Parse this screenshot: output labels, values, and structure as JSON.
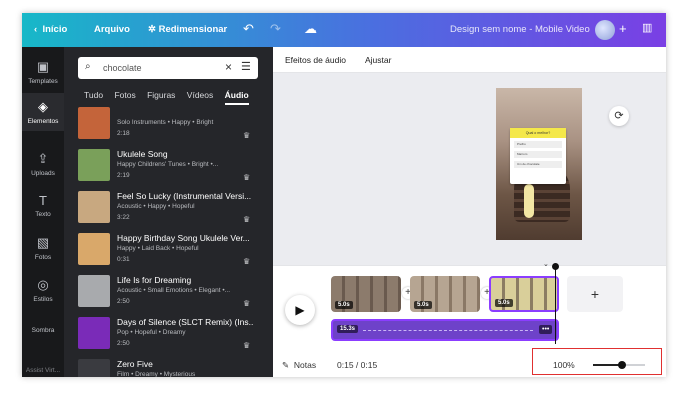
{
  "topbar": {
    "home_label": "Início",
    "file_label": "Arquivo",
    "resize_label": "Redimensionar",
    "doc_name": "Design sem nome - Mobile Video"
  },
  "rail": {
    "items": [
      {
        "label": "Templates",
        "icon": "templates-icon"
      },
      {
        "label": "Elementos",
        "icon": "elements-icon"
      },
      {
        "label": "Uploads",
        "icon": "upload-icon"
      },
      {
        "label": "Texto",
        "icon": "text-icon"
      },
      {
        "label": "Fotos",
        "icon": "photo-icon"
      },
      {
        "label": "Estilos",
        "icon": "palette-icon"
      },
      {
        "label": "Sombra",
        "icon": "shadow-icon"
      },
      {
        "label": "Assist Virt...",
        "icon": "assistant-icon"
      }
    ]
  },
  "panel": {
    "search_value": "chocolate",
    "categories": [
      "Tudo",
      "Fotos",
      "Figuras",
      "Vídeos",
      "Áudio"
    ],
    "active_category": "Áudio",
    "tracks": [
      {
        "title": "",
        "meta": "Solo Instruments • Happy • Bright",
        "duration": "2:18",
        "color": "#c4643a"
      },
      {
        "title": "Ukulele Song",
        "meta": "Happy Childrens' Tunes • Bright •...",
        "duration": "2:19",
        "color": "#7aa05a"
      },
      {
        "title": "Feel So Lucky (Instrumental Versi...",
        "meta": "Acoustic • Happy • Hopeful",
        "duration": "3:22",
        "color": "#c8a880"
      },
      {
        "title": "Happy Birthday Song Ukulele Ver...",
        "meta": "Happy • Laid Back • Hopeful",
        "duration": "0:31",
        "color": "#d9a86a"
      },
      {
        "title": "Life Is for Dreaming",
        "meta": "Acoustic • Small Emotions • Elegant •...",
        "duration": "2:50",
        "color": "#a8aaad"
      },
      {
        "title": "Days of Silence (SLCT Remix) (Ins...",
        "meta": "Pop • Hopeful • Dreamy",
        "duration": "2:50",
        "color": "#7a2bb8"
      },
      {
        "title": "Zero Five",
        "meta": "Film • Dreamy • Mysterious",
        "duration": "1:53",
        "color": "#3a3b40"
      }
    ]
  },
  "toolbar": {
    "audio_effects": "Efeitos de áudio",
    "adjust": "Ajustar"
  },
  "canvas": {
    "quiz_title": "Qual o melhor?",
    "quiz_options": [
      "Prefiro",
      "Marrom",
      "Um de chocolate"
    ]
  },
  "timeline": {
    "clips": [
      {
        "duration": "5.0s"
      },
      {
        "duration": "5.0s"
      },
      {
        "duration": "5.0s"
      }
    ],
    "audio_duration": "15.3s",
    "audio_more": "•••"
  },
  "bottombar": {
    "notes_label": "Notas",
    "time": "0:15 / 0:15",
    "zoom_label": "100%",
    "zoom_level": 0.55
  }
}
